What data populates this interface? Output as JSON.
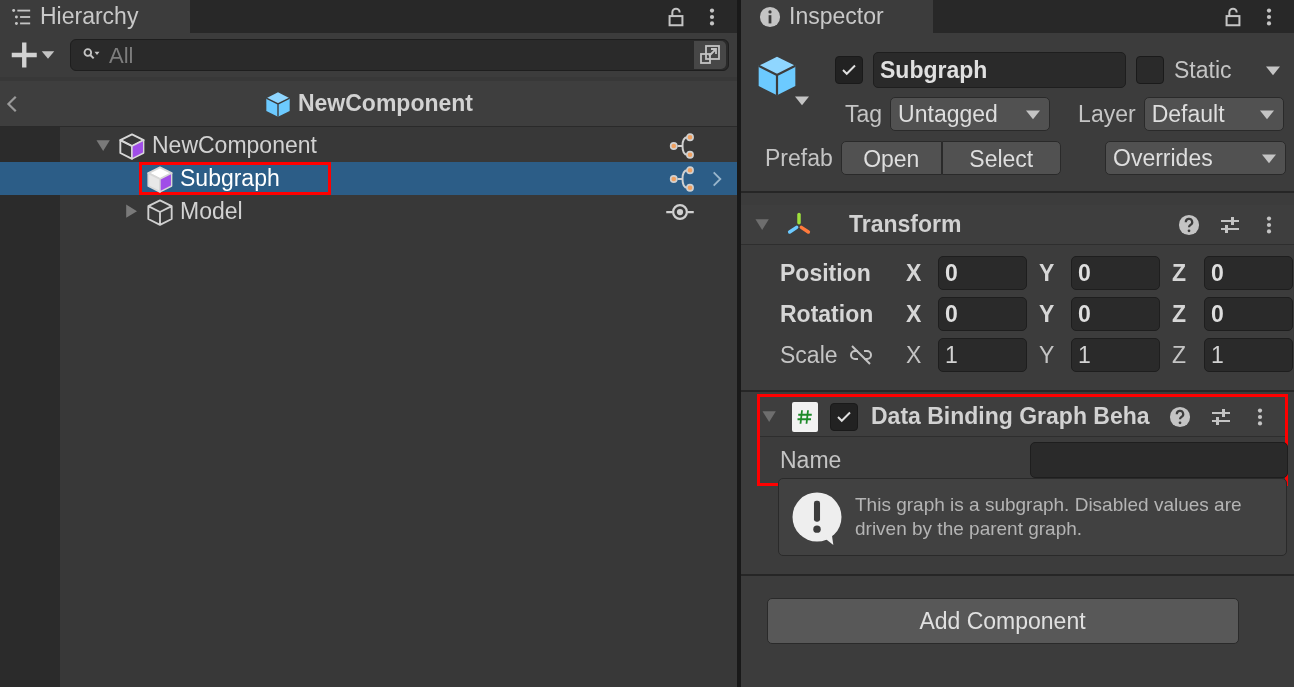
{
  "hierarchy": {
    "tab": {
      "label": "Hierarchy"
    },
    "search": {
      "placeholder": "All"
    },
    "breadcrumb": "NewComponent",
    "items": [
      {
        "label": "NewComponent",
        "kind": "prefab",
        "expanded": true,
        "selected": false,
        "highlighted": false,
        "children": [
          {
            "label": "Subgraph",
            "kind": "prefab",
            "selected": true,
            "highlighted": true
          },
          {
            "label": "Model",
            "kind": "model",
            "expanded": false,
            "selected": false,
            "highlighted": false
          }
        ]
      }
    ]
  },
  "inspector": {
    "tab": {
      "label": "Inspector"
    },
    "object": {
      "active": true,
      "name": "Subgraph",
      "static": false,
      "static_label": "Static",
      "tag_label": "Tag",
      "tag": "Untagged",
      "layer_label": "Layer",
      "layer": "Default",
      "prefab_label": "Prefab",
      "prefab_buttons": [
        "Open",
        "Select"
      ],
      "overrides": "Overrides"
    },
    "components": [
      {
        "kind": "transform",
        "title": "Transform",
        "expanded": true,
        "highlighted": false,
        "fields": [
          {
            "label": "Position",
            "overridden": true,
            "values": [
              {
                "axis": "X",
                "value": "0"
              },
              {
                "axis": "Y",
                "value": "0"
              },
              {
                "axis": "Z",
                "value": "0"
              }
            ]
          },
          {
            "label": "Rotation",
            "overridden": true,
            "values": [
              {
                "axis": "X",
                "value": "0"
              },
              {
                "axis": "Y",
                "value": "0"
              },
              {
                "axis": "Z",
                "value": "0"
              }
            ]
          },
          {
            "label": "Scale",
            "overridden": false,
            "proportions_linked": false,
            "values": [
              {
                "axis": "X",
                "value": "1"
              },
              {
                "axis": "Y",
                "value": "1"
              },
              {
                "axis": "Z",
                "value": "1"
              }
            ]
          }
        ]
      },
      {
        "kind": "script",
        "title": "Data Binding Graph Beha",
        "expanded": true,
        "enabled": true,
        "highlighted": true,
        "properties": [
          {
            "label": "Name"
          }
        ],
        "help_box": {
          "text": "This graph is a subgraph. Disabled values are driven by the parent graph."
        }
      }
    ],
    "add_component": "Add Component"
  }
}
